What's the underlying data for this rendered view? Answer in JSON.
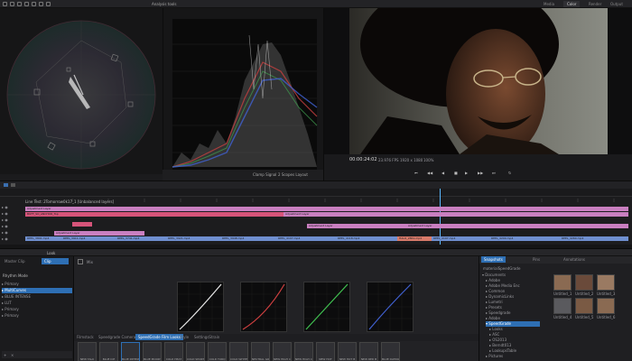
{
  "topbar": {
    "tabs": [
      "Media",
      "Color",
      "Render",
      "Output"
    ],
    "active_tab": "Color",
    "panel_title": "Analysis tools"
  },
  "viewer": {
    "timecode": "00:00:24:02",
    "fps": "23.976 FPS",
    "resolution": "1920 x 1080",
    "viewer_label": "Clamp Signal",
    "channel_label": "2 Scopes Layout",
    "zoom": "100%"
  },
  "timeline": {
    "track_title": "Line Test: 2Tomorrow0k17_1 [Unbalanced layers]",
    "clip_labels": [
      "BUFF_SO_ANCHOR_Top",
      "Adjustment Layer",
      "Adjustment Layer",
      "Adjustment Layer",
      "Adjustment Layer",
      "Adjustment Layer",
      "HALO_2861.mp4",
      "REEL_3891.mp4",
      "REEL_3911.mp4",
      "REEL_3741.mp4",
      "REEL_3921.mp4",
      "REEL_3948.mp4",
      "REEL_4107.mp4",
      "REEL_4118.mp4",
      "REEL_4197.mp4",
      "REEL_4200.mp4",
      "REEL_4260.mp4"
    ]
  },
  "layers": {
    "header_tabs": [
      "Master Clip",
      "Clip"
    ],
    "active_header": "Clip",
    "section": "Rhythm Mode",
    "rows": [
      "Primary",
      "MultiCurves",
      "BLUE INTENSE",
      "LUT",
      "Primary",
      "Primary"
    ]
  },
  "grade": {
    "toolbar_label": "Mix",
    "look_tabs": [
      "Filmstock",
      "Speedgrade Camera Preview",
      "SpeedGrade Film Looks",
      "Style",
      "SettingsStrain"
    ],
    "looks": [
      "NEW TALK",
      "BLUE ICE",
      "BLUE INTENSE",
      "BLUE MOODY",
      "COLD HEAT",
      "COLD SPORT",
      "COLD TURQ",
      "COLD WHITE",
      "NEUTRAL GR",
      "NEW HIGH C",
      "NEW HIGH C2",
      "NEW HOT",
      "NEW HOT B",
      "NEW RED B",
      "BLUE DATING"
    ]
  },
  "browser": {
    "tabs": [
      "Snapshots",
      "Pins",
      "Annotations"
    ],
    "active_tab": "Snapshots",
    "path": "materialSpeedGrade",
    "folders": [
      "Documents",
      "Adobe",
      "Adobe Media Enc",
      "Common",
      "DynamicLinks",
      "Lumetri",
      "Presets",
      "Speedgrade",
      "Adobe",
      "SpeedGrade",
      "Looks",
      "ASC",
      "OS2013",
      "Berndt013",
      "LookupsTable",
      "OS2013",
      "LUTs",
      "Pictures"
    ],
    "thumbs": [
      "Untitled_1",
      "Untitled_2",
      "Untitled_3",
      "Untitled_4",
      "Untitled_5",
      "Untitled_6"
    ]
  },
  "colors": {
    "accent": "#2e6fb4",
    "clip_pink": "#c97fc0",
    "clip_red": "#d6547a",
    "clip_blue": "#6f8fd0"
  }
}
